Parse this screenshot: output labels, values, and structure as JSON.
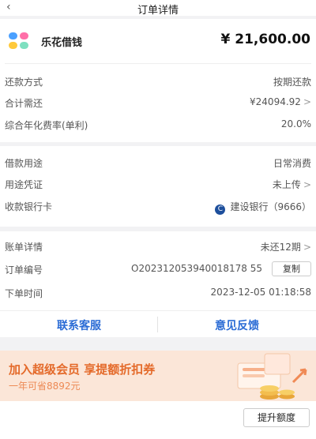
{
  "header": {
    "back_icon": "chevron-left-icon",
    "title": "订单详情"
  },
  "summary": {
    "brand_icon": "lehua-logo-icon",
    "brand": "乐花借钱",
    "amount": "¥ 21,600.00"
  },
  "details": [
    {
      "label": "还款方式",
      "value": "按期还款"
    },
    {
      "label": "合计需还",
      "value": "¥24094.92",
      "arrow": ">"
    },
    {
      "label": "综合年化费率(单利)",
      "value": "20.0%"
    }
  ],
  "usage": [
    {
      "label": "借款用途",
      "value": "日常消费"
    },
    {
      "label": "用途凭证",
      "value": "未上传",
      "arrow": ">"
    },
    {
      "label": "收款银行卡",
      "bank_icon": "ccb-bank-icon",
      "value": "建设银行（9666）"
    }
  ],
  "bill": {
    "detail_label": "账单详情",
    "detail_value": "未还12期",
    "detail_arrow": ">",
    "order_no_label": "订单编号",
    "order_no": "O202312053940018178 55",
    "copy_label": "复制",
    "time_label": "下单时间",
    "time": "2023-12-05 01:18:58"
  },
  "actions": {
    "service": "联系客服",
    "feedback": "意见反馈"
  },
  "banner": {
    "title": "加入超级会员 享提额折扣券",
    "subtitle": "一年可省8892元",
    "art_icon": "gift-coins-icon"
  },
  "footer": {
    "raise_label": "提升额度"
  },
  "colors": {
    "accent_blue": "#2a6bd5",
    "banner_orange": "#e46a2a",
    "banner_bg": "#fbe6d8"
  }
}
